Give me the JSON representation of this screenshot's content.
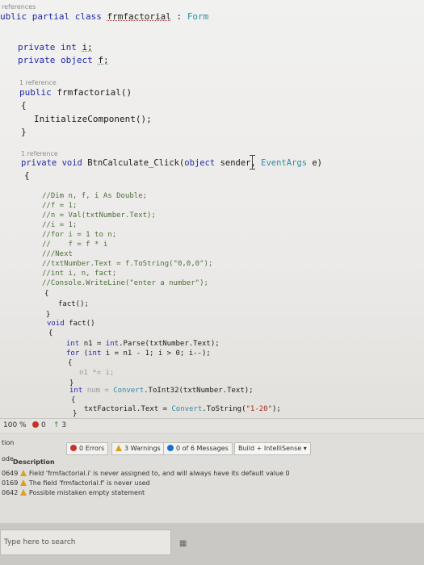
{
  "code": {
    "codelens_top": "references",
    "class_decl": [
      "ublic partial class ",
      "frmfactorial",
      " : ",
      "Form"
    ],
    "field_i": [
      "private ",
      "int ",
      "i;"
    ],
    "field_f": [
      "private ",
      "object ",
      "f;"
    ],
    "codelens_ctor": "1 reference",
    "ctor_decl": [
      "public ",
      "frmfactorial()"
    ],
    "brace_open": "{",
    "init_call": "InitializeComponent();",
    "brace_close": "}",
    "codelens_btn": "1 reference",
    "btn_decl": [
      "private ",
      "void ",
      "BtnCalculate_Click(",
      "object ",
      "sender, ",
      "EventArgs ",
      "e)"
    ],
    "body": [
      "//Dim n, f, i As Double;",
      "//f = 1;",
      "//n = Val(txtNumber.Text);",
      "//i = 1;",
      "//for i = 1 to n;",
      "//    f = f * i",
      "///Next",
      "//txtNumber.Text = f.ToString(\"0,0,0\");",
      "//int i, n, fact;",
      "//Console.WriteLine(\"enter a number\");"
    ],
    "fact_call": "fact();",
    "fact_decl": [
      "void ",
      "fact()"
    ],
    "parse_line": [
      "int ",
      "n1 = ",
      "int",
      ".Parse(txtNumber.Text);"
    ],
    "for_line": [
      "for ",
      "(",
      "int ",
      "i = n1 - 1; i > 0; i--);"
    ],
    "mult_line": "n1 *= i;",
    "num_line": [
      "int ",
      "num = ",
      "Convert",
      ".ToInt32(txtNumber.Text);"
    ],
    "result_line": [
      "txtFactorial.Text = ",
      "Convert",
      ".ToString(",
      "\"1-20\"",
      ");"
    ]
  },
  "editor_footer": {
    "zoom": "100 %",
    "issues": "0",
    "changes": "3"
  },
  "error_list": {
    "side_labels": [
      "tion",
      "ode"
    ],
    "errors_label": "0 Errors",
    "warnings_label": "3 Warnings",
    "messages_label": "0 of 6 Messages",
    "build_filter": "Build + IntelliSense",
    "col_description": "Description",
    "rows": [
      {
        "code": "0649",
        "text": "Field 'frmfactorial.i' is never assigned to, and will always have its default value 0"
      },
      {
        "code": "0169",
        "text": "The field 'frmfactorial.f' is never used"
      },
      {
        "code": "0642",
        "text": "Possible mistaken empty statement"
      }
    ]
  },
  "taskbar": {
    "search_placeholder": "Type here to search"
  },
  "colors": {
    "keyword": "#1f2aa8",
    "type": "#2b8ca3",
    "string": "#a3301e",
    "comment": "#4b6f3a",
    "error_red": "#c8322b",
    "warning_yellow": "#d8a21a",
    "info_blue": "#1a6fd1"
  }
}
